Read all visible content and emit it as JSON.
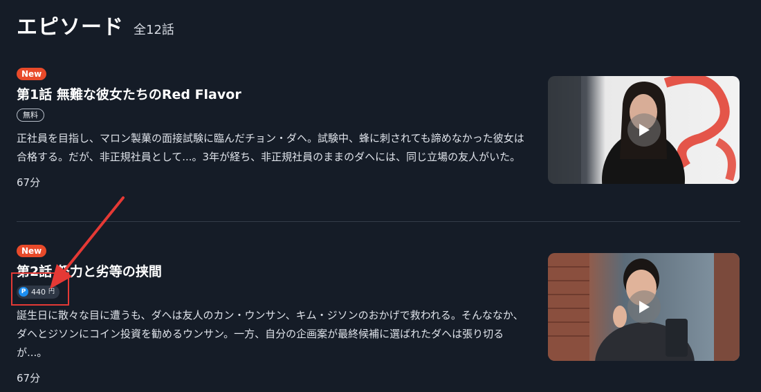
{
  "header": {
    "title": "エピソード",
    "count": "全12話"
  },
  "episodes": [
    {
      "badge": "New",
      "title": "第1話 無難な彼女たちのRed Flavor",
      "price_label": "無料",
      "description": "正社員を目指し、マロン製菓の面接試験に臨んだチョン・ダヘ。試験中、蜂に刺されても諦めなかった彼女は合格する。だが、非正規社員として...。3年が経ち、非正規社員のままのダヘには、同じ立場の友人がいた。",
      "duration": "67分"
    },
    {
      "badge": "New",
      "title": "第2話 努力と劣等の挟間",
      "price_icon": "P",
      "price_amount": "440",
      "price_unit": "円",
      "description": "誕生日に散々な目に遭うも、ダヘは友人のカン・ウンサン、キム・ジソンのおかげで救われる。そんななか、ダヘとジソンにコイン投資を勧めるウンサン。一方、自分の企画案が最終候補に選ばれたダヘは張り切るが...。",
      "duration": "67分"
    }
  ],
  "icons": {
    "play": "play-icon",
    "points": "point-icon"
  },
  "colors": {
    "background": "#151c27",
    "new_badge": "#e84a2a",
    "annotation": "#e53935",
    "point": "#1c8ef0"
  }
}
